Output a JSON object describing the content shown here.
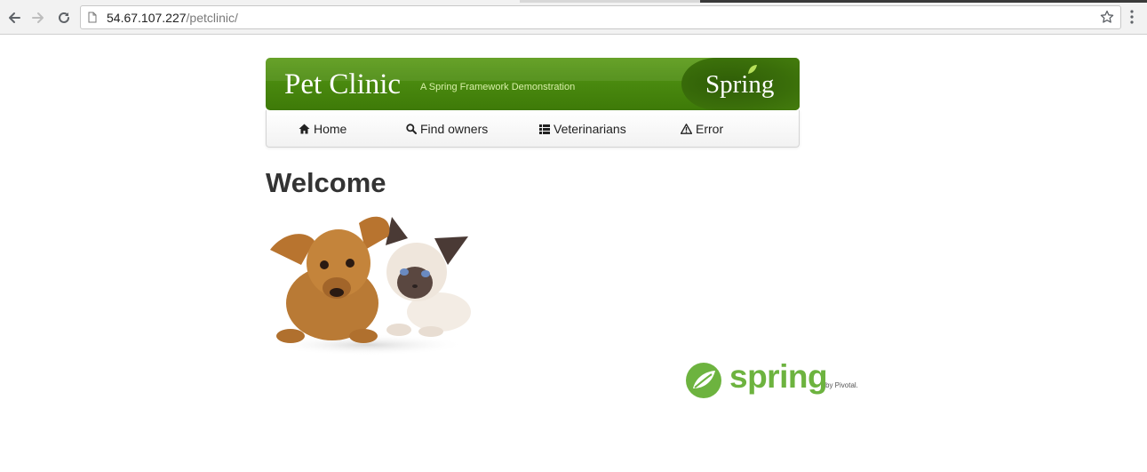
{
  "browser": {
    "url_host": "54.67.107.227",
    "url_path": "/petclinic/",
    "back_icon": "arrow-left-icon",
    "forward_icon": "arrow-right-icon",
    "reload_icon": "reload-icon",
    "bookmark_icon": "star-icon",
    "menu_icon": "kebab-menu-icon"
  },
  "header": {
    "title": "Pet Clinic",
    "subtitle": "A Spring Framework Demonstration",
    "brand": "Spring",
    "colors": {
      "banner_green": "#4a8a0f",
      "subtitle_green": "#d8f0a8"
    }
  },
  "nav": {
    "items": [
      {
        "label": "Home",
        "icon": "home-icon"
      },
      {
        "label": "Find owners",
        "icon": "search-icon"
      },
      {
        "label": "Veterinarians",
        "icon": "list-icon"
      },
      {
        "label": "Error",
        "icon": "warning-icon"
      }
    ]
  },
  "main": {
    "heading": "Welcome",
    "image": "puppy-and-kitten-photo"
  },
  "footer": {
    "logo_word": "spring",
    "logo_by": "by Pivotal.",
    "colors": {
      "spring_green": "#6db33f"
    }
  }
}
